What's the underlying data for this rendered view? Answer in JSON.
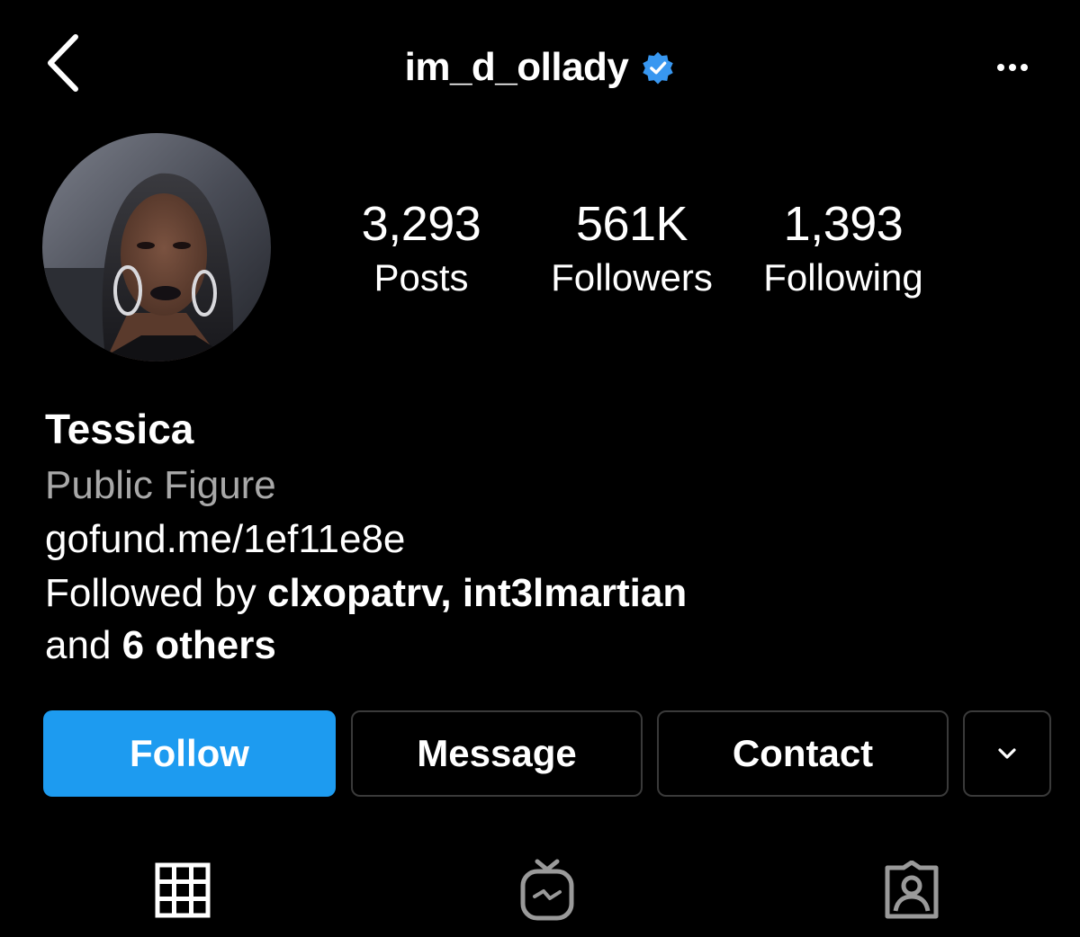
{
  "header": {
    "username": "im_d_ollady",
    "verified": true,
    "back_icon": "chevron-left-icon",
    "more_icon": "more-horizontal-icon"
  },
  "profile": {
    "avatar_icon": "profile-photo",
    "stats": [
      {
        "value": "3,293",
        "label": "Posts"
      },
      {
        "value": "561K",
        "label": "Followers"
      },
      {
        "value": "1,393",
        "label": "Following"
      }
    ]
  },
  "bio": {
    "name": "Tessica",
    "category": "Public Figure",
    "link": "gofund.me/1ef11e8e",
    "followed_by_prefix": "Followed by ",
    "followed_by_users": "clxopatrv, int3lmartian",
    "followed_by_and": "and ",
    "followed_by_others": "6 others"
  },
  "actions": {
    "follow": "Follow",
    "message": "Message",
    "contact": "Contact",
    "more_icon": "chevron-down-icon"
  },
  "tabs": [
    {
      "icon": "grid-icon"
    },
    {
      "icon": "igtv-icon"
    },
    {
      "icon": "tagged-icon"
    }
  ],
  "colors": {
    "background": "#000000",
    "primary_button": "#1d9bf0",
    "verified_badge": "#3897f0",
    "secondary_text": "#a8a8a8"
  }
}
